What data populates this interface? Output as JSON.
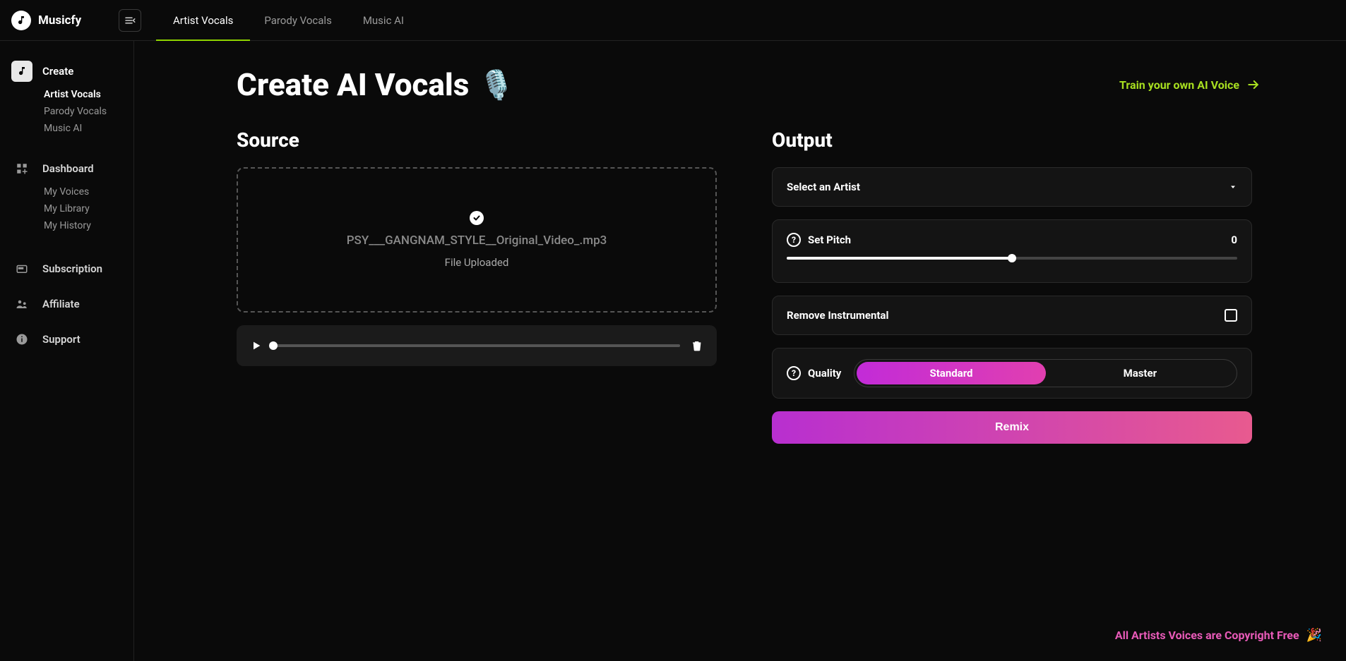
{
  "brand": {
    "name": "Musicfy"
  },
  "topnav": {
    "items": [
      {
        "label": "Artist Vocals",
        "active": true
      },
      {
        "label": "Parody Vocals",
        "active": false
      },
      {
        "label": "Music AI",
        "active": false
      }
    ]
  },
  "sidebar": {
    "create": {
      "label": "Create",
      "children": [
        {
          "label": "Artist Vocals",
          "active": true
        },
        {
          "label": "Parody Vocals",
          "active": false
        },
        {
          "label": "Music AI",
          "active": false
        }
      ]
    },
    "dashboard": {
      "label": "Dashboard",
      "children": [
        {
          "label": "My Voices"
        },
        {
          "label": "My Library"
        },
        {
          "label": "My History"
        }
      ]
    },
    "subscription": {
      "label": "Subscription"
    },
    "affiliate": {
      "label": "Affiliate"
    },
    "support": {
      "label": "Support"
    }
  },
  "page": {
    "title": "Create AI Vocals",
    "train_link": "Train your own AI Voice"
  },
  "source": {
    "heading": "Source",
    "file_name": "PSY___GANGNAM_STYLE__Original_Video_.mp3",
    "status": "File Uploaded",
    "progress_percent": 0
  },
  "output": {
    "heading": "Output",
    "artist_placeholder": "Select an Artist",
    "pitch": {
      "label": "Set Pitch",
      "value": "0",
      "percent": 50
    },
    "remove_instrumental": {
      "label": "Remove Instrumental",
      "checked": false
    },
    "quality": {
      "label": "Quality",
      "options": [
        {
          "label": "Standard",
          "active": true
        },
        {
          "label": "Master",
          "active": false
        }
      ]
    },
    "remix_label": "Remix"
  },
  "footer": {
    "copyright_note": "All Artists Voices are Copyright Free"
  }
}
